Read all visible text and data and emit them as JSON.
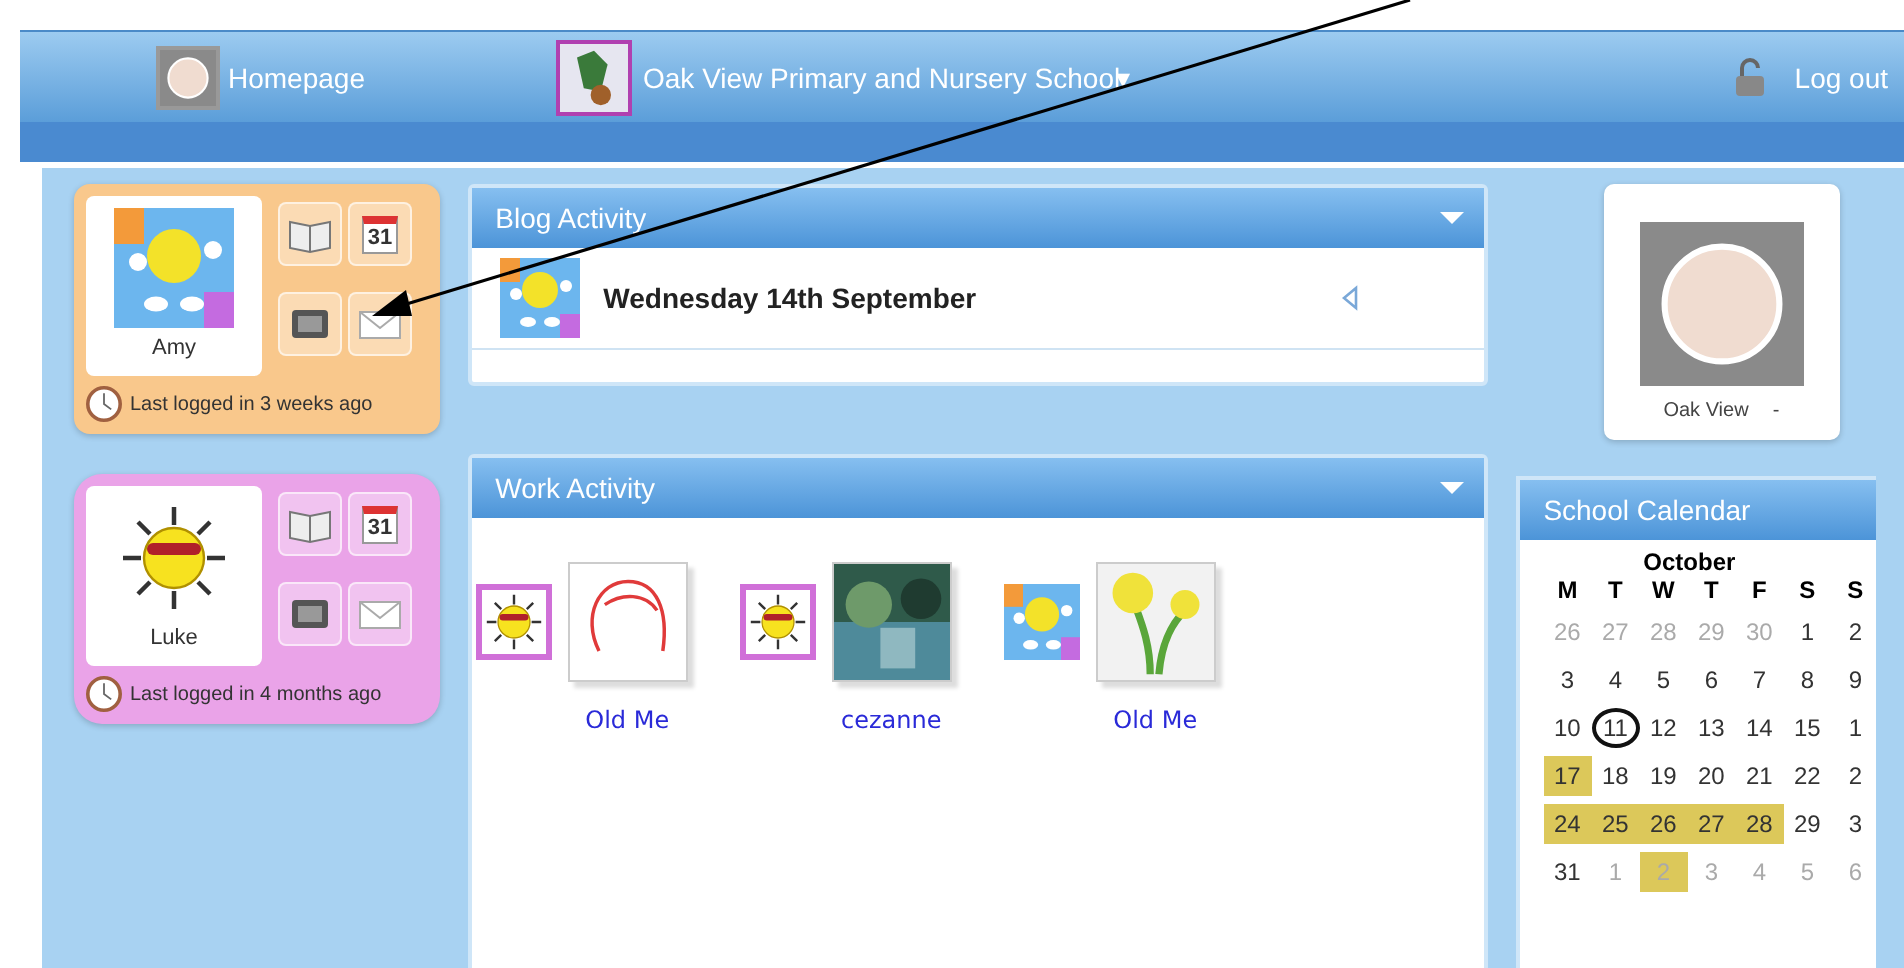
{
  "nav": {
    "home": "Homepage",
    "school": "Oak View Primary and Nursery School",
    "dropdown": "▾",
    "logout": "Log out"
  },
  "pupils": [
    {
      "name": "Amy",
      "last_login": "Last logged in 3 weeks ago",
      "color": "#f9c88c",
      "calendar_label": "31"
    },
    {
      "name": "Luke",
      "last_login": "Last logged in 4 months ago",
      "color": "#eaa3e8",
      "calendar_label": "31"
    }
  ],
  "blog": {
    "title": "Blog Activity",
    "entries": [
      {
        "title": "Wednesday 14th September"
      }
    ]
  },
  "work": {
    "title": "Work Activity",
    "items": [
      {
        "title": "Old Me"
      },
      {
        "title": "cezanne"
      },
      {
        "title": "Old Me"
      }
    ]
  },
  "profile": {
    "name": "Oak View",
    "menu": "-"
  },
  "calendar": {
    "title": "School Calendar",
    "month": "October",
    "weekdays": [
      "M",
      "T",
      "W",
      "T",
      "F",
      "S",
      "S"
    ],
    "days": [
      {
        "label": "26",
        "other_month": true,
        "highlighted": false,
        "today": false
      },
      {
        "label": "27",
        "other_month": true,
        "highlighted": false,
        "today": false
      },
      {
        "label": "28",
        "other_month": true,
        "highlighted": false,
        "today": false
      },
      {
        "label": "29",
        "other_month": true,
        "highlighted": false,
        "today": false
      },
      {
        "label": "30",
        "other_month": true,
        "highlighted": false,
        "today": false
      },
      {
        "label": "1",
        "other_month": false,
        "highlighted": false,
        "today": false
      },
      {
        "label": "2",
        "other_month": false,
        "highlighted": false,
        "today": false
      },
      {
        "label": "3",
        "other_month": false,
        "highlighted": false,
        "today": false
      },
      {
        "label": "4",
        "other_month": false,
        "highlighted": false,
        "today": false
      },
      {
        "label": "5",
        "other_month": false,
        "highlighted": false,
        "today": false
      },
      {
        "label": "6",
        "other_month": false,
        "highlighted": false,
        "today": false
      },
      {
        "label": "7",
        "other_month": false,
        "highlighted": false,
        "today": false
      },
      {
        "label": "8",
        "other_month": false,
        "highlighted": false,
        "today": false
      },
      {
        "label": "9",
        "other_month": false,
        "highlighted": false,
        "today": false
      },
      {
        "label": "10",
        "other_month": false,
        "highlighted": false,
        "today": false
      },
      {
        "label": "11",
        "other_month": false,
        "highlighted": false,
        "today": true
      },
      {
        "label": "12",
        "other_month": false,
        "highlighted": false,
        "today": false
      },
      {
        "label": "13",
        "other_month": false,
        "highlighted": false,
        "today": false
      },
      {
        "label": "14",
        "other_month": false,
        "highlighted": false,
        "today": false
      },
      {
        "label": "15",
        "other_month": false,
        "highlighted": false,
        "today": false
      },
      {
        "label": "1",
        "other_month": false,
        "highlighted": false,
        "today": false
      },
      {
        "label": "17",
        "other_month": false,
        "highlighted": true,
        "today": false
      },
      {
        "label": "18",
        "other_month": false,
        "highlighted": false,
        "today": false
      },
      {
        "label": "19",
        "other_month": false,
        "highlighted": false,
        "today": false
      },
      {
        "label": "20",
        "other_month": false,
        "highlighted": false,
        "today": false
      },
      {
        "label": "21",
        "other_month": false,
        "highlighted": false,
        "today": false
      },
      {
        "label": "22",
        "other_month": false,
        "highlighted": false,
        "today": false
      },
      {
        "label": "2",
        "other_month": false,
        "highlighted": false,
        "today": false
      },
      {
        "label": "24",
        "other_month": false,
        "highlighted": true,
        "today": false
      },
      {
        "label": "25",
        "other_month": false,
        "highlighted": true,
        "today": false
      },
      {
        "label": "26",
        "other_month": false,
        "highlighted": true,
        "today": false
      },
      {
        "label": "27",
        "other_month": false,
        "highlighted": true,
        "today": false
      },
      {
        "label": "28",
        "other_month": false,
        "highlighted": true,
        "today": false
      },
      {
        "label": "29",
        "other_month": false,
        "highlighted": false,
        "today": false
      },
      {
        "label": "3",
        "other_month": false,
        "highlighted": false,
        "today": false
      },
      {
        "label": "31",
        "other_month": false,
        "highlighted": false,
        "today": false
      },
      {
        "label": "1",
        "other_month": true,
        "highlighted": false,
        "today": false
      },
      {
        "label": "2",
        "other_month": true,
        "highlighted": true,
        "today": false
      },
      {
        "label": "3",
        "other_month": true,
        "highlighted": false,
        "today": false
      },
      {
        "label": "4",
        "other_month": true,
        "highlighted": false,
        "today": false
      },
      {
        "label": "5",
        "other_month": true,
        "highlighted": false,
        "today": false
      },
      {
        "label": "6",
        "other_month": true,
        "highlighted": false,
        "today": false
      }
    ]
  }
}
